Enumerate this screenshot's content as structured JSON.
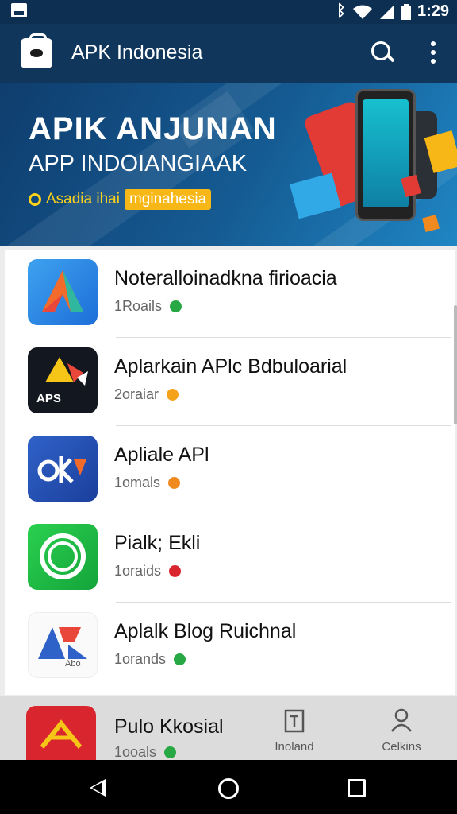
{
  "status_bar": {
    "time": "1:29",
    "icons": [
      "notification-icon",
      "bluetooth-icon",
      "wifi-icon",
      "signal-icon",
      "battery-icon"
    ]
  },
  "app_bar": {
    "title": "APK Indonesia",
    "actions": [
      "search-icon",
      "more-vert-icon"
    ]
  },
  "banner": {
    "headline": "APIK ANJUNAN",
    "subheadline": "APP INDOIANGIAAK",
    "tagline_a": "Asadia ihai",
    "tagline_b": "mginahesia"
  },
  "apps": [
    {
      "name": "Noteralloinadkna firioacia",
      "meta": "1Roails",
      "badge_color": "#27a844",
      "icon": "bird-icon"
    },
    {
      "name": "Aplarkain APlc Bdbuloarial",
      "meta": "2oraiar",
      "badge_color": "#f5a21b",
      "icon": "aps-icon",
      "icon_text": "APS"
    },
    {
      "name": "Apliale APl",
      "meta": "1omals",
      "badge_color": "#f08a1e",
      "icon": "apk-icon"
    },
    {
      "name": "Pialk; Ekli",
      "meta": "1oraids",
      "badge_color": "#d9262e",
      "icon": "chat-icon"
    },
    {
      "name": "Aplalk Blog Ruichnal",
      "meta": "1orands",
      "badge_color": "#27a844",
      "icon": "ap-icon",
      "icon_text": "Abo"
    },
    {
      "name": "Pulo Kkosial",
      "meta": "1ooals",
      "badge_color": "#27a844",
      "icon": "ak-icon"
    }
  ],
  "bottom_nav": [
    {
      "label": "Inoland",
      "icon": "download-icon"
    },
    {
      "label": "Celkins",
      "icon": "person-icon"
    }
  ],
  "colors": {
    "primary": "#10365c",
    "status": "#0d2f52",
    "accent": "#f7b716"
  }
}
